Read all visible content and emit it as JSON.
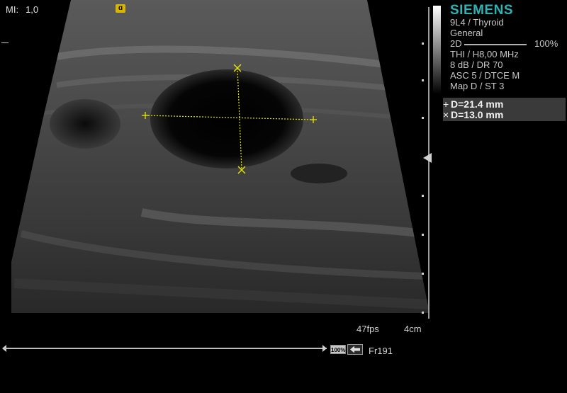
{
  "mechanical_index": {
    "label": "MI:",
    "value": "1,0"
  },
  "brand": "SIEMENS",
  "probe_preset": "9L4 / Thyroid",
  "preset_group": "General",
  "mode": {
    "label": "2D",
    "value": "100%"
  },
  "params": [
    "THI / H8,00 MHz",
    "8 dB / DR 70",
    "ASC 5 / DTCE M",
    "Map D / ST 3"
  ],
  "measurements": [
    {
      "symbol": "+",
      "text": "D=21.4 mm"
    },
    {
      "symbol": "×",
      "text": "D=13.0 mm"
    }
  ],
  "frame_rate": "47fps",
  "depth": "4cm",
  "zoom": "100%",
  "frame_number": "Fr191"
}
